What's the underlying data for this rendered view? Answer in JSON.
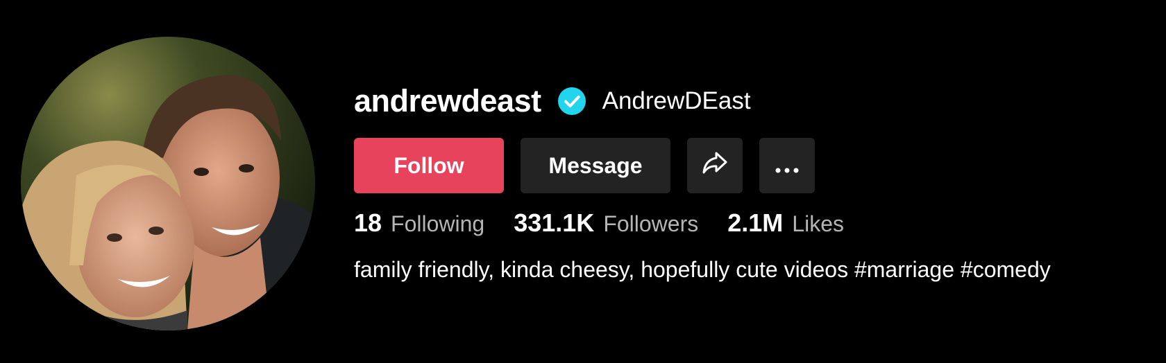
{
  "profile": {
    "username": "andrewdeast",
    "nickname": "AndrewDEast",
    "verified": true,
    "bio": "family friendly, kinda cheesy, hopefully cute videos #marriage #comedy"
  },
  "actions": {
    "follow_label": "Follow",
    "message_label": "Message",
    "share_icon": "share-arrow-icon",
    "more_icon": "more-horizontal-icon"
  },
  "stats": [
    {
      "value": "18",
      "label": "Following"
    },
    {
      "value": "331.1K",
      "label": "Followers"
    },
    {
      "value": "2.1M",
      "label": "Likes"
    }
  ],
  "colors": {
    "background": "#000000",
    "follow_button": "#e8435c",
    "secondary_button": "#232323",
    "verified_badge": "#20d5ec",
    "stat_label": "#b5b5b5"
  }
}
